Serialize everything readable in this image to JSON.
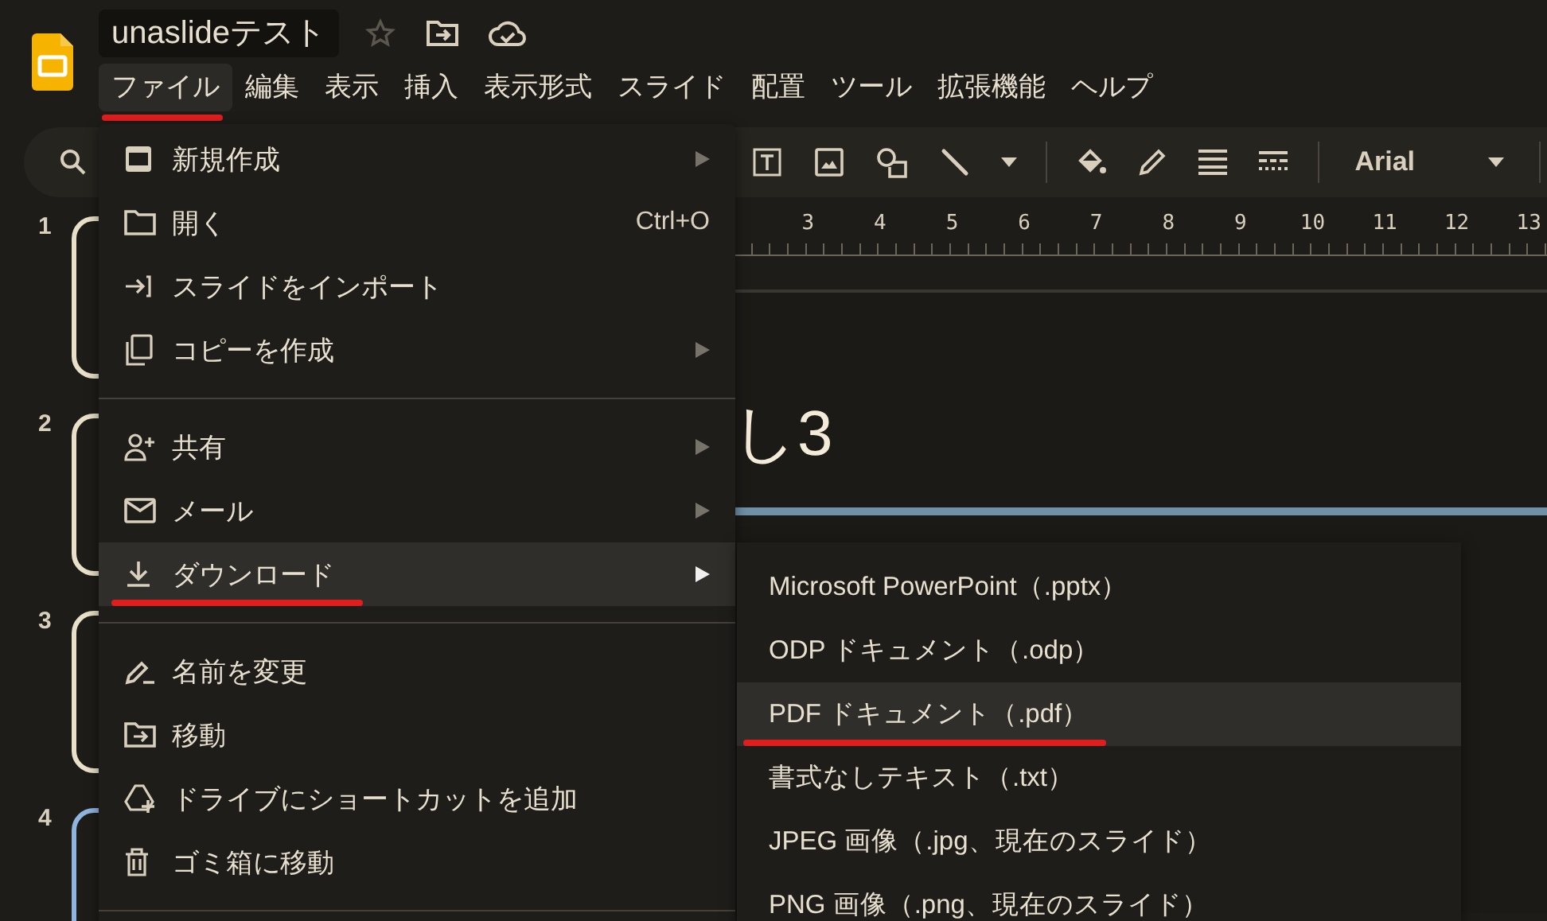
{
  "document": {
    "title": "unaslideテスト"
  },
  "menubar": [
    {
      "label": "ファイル",
      "selected": true,
      "underlined": true
    },
    {
      "label": "編集",
      "selected": false,
      "underlined": false
    },
    {
      "label": "表示",
      "selected": false,
      "underlined": false
    },
    {
      "label": "挿入",
      "selected": false,
      "underlined": false
    },
    {
      "label": "表示形式",
      "selected": false,
      "underlined": false
    },
    {
      "label": "スライド",
      "selected": false,
      "underlined": false
    },
    {
      "label": "配置",
      "selected": false,
      "underlined": false
    },
    {
      "label": "ツール",
      "selected": false,
      "underlined": false
    },
    {
      "label": "拡張機能",
      "selected": false,
      "underlined": false
    },
    {
      "label": "ヘルプ",
      "selected": false,
      "underlined": false
    }
  ],
  "toolbar": {
    "font": "Arial"
  },
  "slides": [
    {
      "number": "1",
      "selected": false
    },
    {
      "number": "2",
      "selected": false
    },
    {
      "number": "3",
      "selected": false
    },
    {
      "number": "4",
      "selected": true
    }
  ],
  "ruler": [
    "3",
    "4",
    "5",
    "6",
    "7",
    "8",
    "9",
    "10",
    "11",
    "12",
    "13"
  ],
  "slide": {
    "title": "し3"
  },
  "file_menu": [
    {
      "kind": "item",
      "label": "新規作成",
      "submenu": true,
      "selected": false,
      "underlined": false
    },
    {
      "kind": "item",
      "label": "開く",
      "shortcut": "Ctrl+O",
      "submenu": false,
      "selected": false,
      "underlined": false
    },
    {
      "kind": "item",
      "label": "スライドをインポート",
      "submenu": false,
      "selected": false,
      "underlined": false
    },
    {
      "kind": "item",
      "label": "コピーを作成",
      "submenu": true,
      "selected": false,
      "underlined": false
    },
    {
      "kind": "separator"
    },
    {
      "kind": "item",
      "label": "共有",
      "submenu": true,
      "selected": false,
      "underlined": false
    },
    {
      "kind": "item",
      "label": "メール",
      "submenu": true,
      "selected": false,
      "underlined": false
    },
    {
      "kind": "item",
      "label": "ダウンロード",
      "submenu": true,
      "selected": true,
      "underlined": true
    },
    {
      "kind": "separator"
    },
    {
      "kind": "item",
      "label": "名前を変更",
      "submenu": false,
      "selected": false,
      "underlined": false
    },
    {
      "kind": "item",
      "label": "移動",
      "submenu": false,
      "selected": false,
      "underlined": false
    },
    {
      "kind": "item",
      "label": "ドライブにショートカットを追加",
      "submenu": false,
      "selected": false,
      "underlined": false
    },
    {
      "kind": "item",
      "label": "ゴミ箱に移動",
      "submenu": false,
      "selected": false,
      "underlined": false
    },
    {
      "kind": "separator"
    }
  ],
  "download_submenu": [
    {
      "label": "Microsoft PowerPoint（.pptx）",
      "selected": false,
      "underlined": false
    },
    {
      "label": "ODP ドキュメント（.odp）",
      "selected": false,
      "underlined": false
    },
    {
      "label": "PDF ドキュメント（.pdf）",
      "selected": true,
      "underlined": true
    },
    {
      "label": "書式なしテキスト（.txt）",
      "selected": false,
      "underlined": false
    },
    {
      "label": "JPEG 画像（.jpg、現在のスライド）",
      "selected": false,
      "underlined": false
    },
    {
      "label": "PNG 画像（.png、現在のスライド）",
      "selected": false,
      "underlined": false
    }
  ]
}
